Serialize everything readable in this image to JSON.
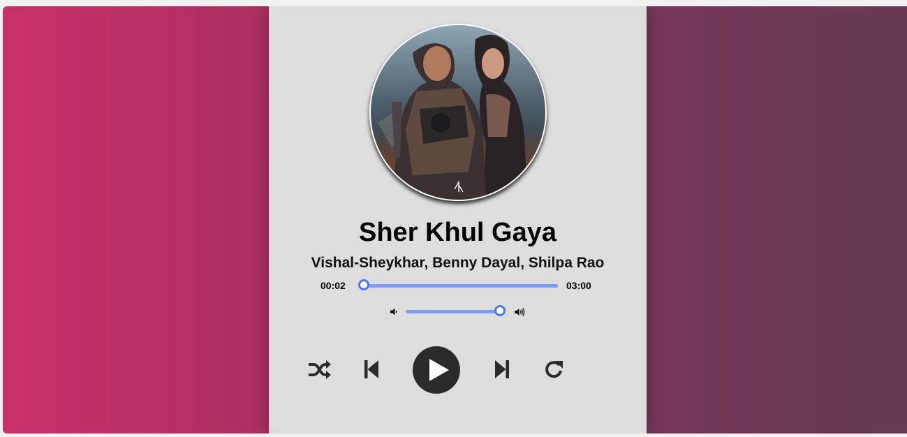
{
  "song": {
    "title": "Sher Khul Gaya",
    "artist": "Vishal-Sheykhar, Benny Dayal, Shilpa Rao"
  },
  "progress": {
    "current_time": "00:02",
    "total_time": "03:00",
    "fraction": 0.011
  },
  "volume": {
    "fraction": 0.95
  },
  "controls": [
    "shuffle-icon",
    "previous-icon",
    "play-icon",
    "next-icon",
    "repeat-icon"
  ],
  "colors": {
    "gradient_left": "#c9306a",
    "gradient_right": "#653a52",
    "player_bg": "#dddddd",
    "slider": "#7f9cf5",
    "slider_knob_border": "#4a78f0",
    "play_button": "#2b2b2b"
  }
}
